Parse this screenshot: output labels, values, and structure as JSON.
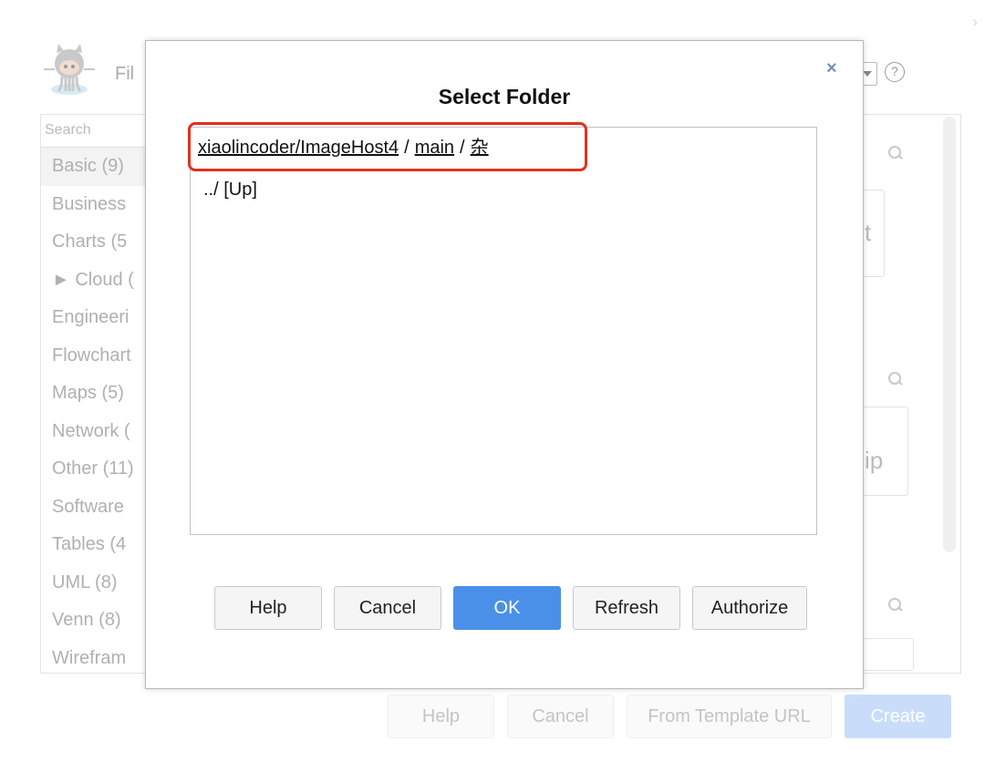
{
  "background": {
    "file_label": "Fil",
    "search_placeholder": "Search",
    "categories": [
      {
        "label": "Basic (9)"
      },
      {
        "label": "Business"
      },
      {
        "label": "Charts (5"
      },
      {
        "label": "► Cloud ("
      },
      {
        "label": "Engineeri"
      },
      {
        "label": "Flowchart"
      },
      {
        "label": "Maps (5)"
      },
      {
        "label": "Network ("
      },
      {
        "label": "Other (11)"
      },
      {
        "label": "Software"
      },
      {
        "label": "Tables (4"
      },
      {
        "label": "UML (8)"
      },
      {
        "label": "Venn (8)"
      },
      {
        "label": "Wirefram"
      }
    ],
    "thumb_texts": {
      "t1": "t",
      "t2": "ip"
    },
    "help_icon": "?",
    "footer": {
      "help": "Help",
      "cancel": "Cancel",
      "from_template_url": "From Template URL",
      "create": "Create"
    }
  },
  "dialog": {
    "title": "Select Folder",
    "close_symbol": "×",
    "breadcrumb": {
      "repo": "xiaolincoder/ImageHost4",
      "separator": "/",
      "branch": "main",
      "folder": "杂"
    },
    "up_entry": "../ [Up]",
    "buttons": {
      "help": "Help",
      "cancel": "Cancel",
      "ok": "OK",
      "refresh": "Refresh",
      "authorize": "Authorize"
    }
  },
  "colors": {
    "primary_button": "#4a90e8",
    "highlight_border": "#e0301e"
  }
}
